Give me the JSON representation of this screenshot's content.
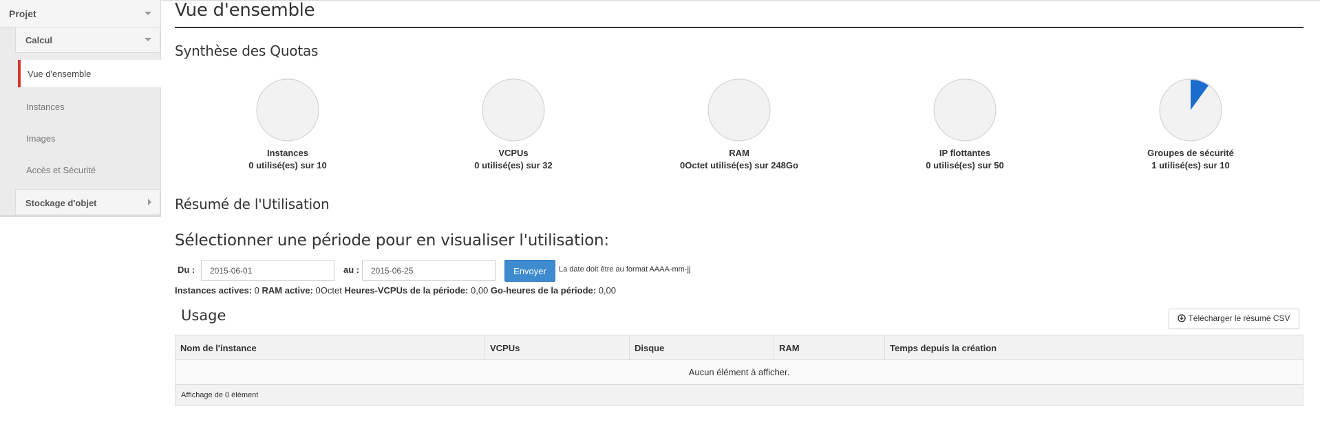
{
  "sidebar": {
    "project_label": "Projet",
    "compute_label": "Calcul",
    "items": [
      {
        "label": "Vue d'ensemble",
        "active": true
      },
      {
        "label": "Instances"
      },
      {
        "label": "Images"
      },
      {
        "label": "Accès et Sécurité"
      }
    ],
    "storage_label": "Stockage d'objet",
    "accent_color": "#d9372d"
  },
  "page": {
    "title": "Vue d'ensemble",
    "quota_title": "Synthèse des Quotas",
    "usage_summary_title": "Résumé de l'Utilisation"
  },
  "quotas": [
    {
      "name": "Instances",
      "usage": "0 utilisé(es) sur 10",
      "used": 0,
      "total": 10
    },
    {
      "name": "VCPUs",
      "usage": "0 utilisé(es) sur 32",
      "used": 0,
      "total": 32
    },
    {
      "name": "RAM",
      "usage": "0Octet utilisé(es) sur 248Go",
      "used": 0,
      "total": 248
    },
    {
      "name": "IP flottantes",
      "usage": "0 utilisé(es) sur 50",
      "used": 0,
      "total": 50
    },
    {
      "name": "Groupes de sécurité",
      "usage": "1 utilisé(es) sur 10",
      "used": 1,
      "total": 10
    }
  ],
  "pie_colors": {
    "used": "#1a6dce",
    "empty": "#f2f2f2",
    "border": "#cccccc"
  },
  "period": {
    "heading": "Sélectionner une période pour en visualiser l'utilisation:",
    "from_label": "Du :",
    "from_value": "2015-06-01",
    "to_label": "au :",
    "to_value": "2015-06-25",
    "submit_label": "Envoyer",
    "help_text": "La date doit être au format AAAA-mm-jj"
  },
  "summary": {
    "active_instances_label": "Instances actives:",
    "active_instances_value": "0",
    "active_ram_label": "RAM active:",
    "active_ram_value": "0Octet",
    "vcpu_hours_label": "Heures-VCPUs de la période:",
    "vcpu_hours_value": "0,00",
    "gb_hours_label": "Go-heures de la période:",
    "gb_hours_value": "0,00"
  },
  "usage": {
    "title": "Usage",
    "csv_button": "Télécharger le résumé CSV",
    "columns": [
      "Nom de l'instance",
      "VCPUs",
      "Disque",
      "RAM",
      "Temps depuis la création"
    ],
    "empty_message": "Aucun élément à afficher.",
    "footer": "Affichage de 0 élément"
  }
}
